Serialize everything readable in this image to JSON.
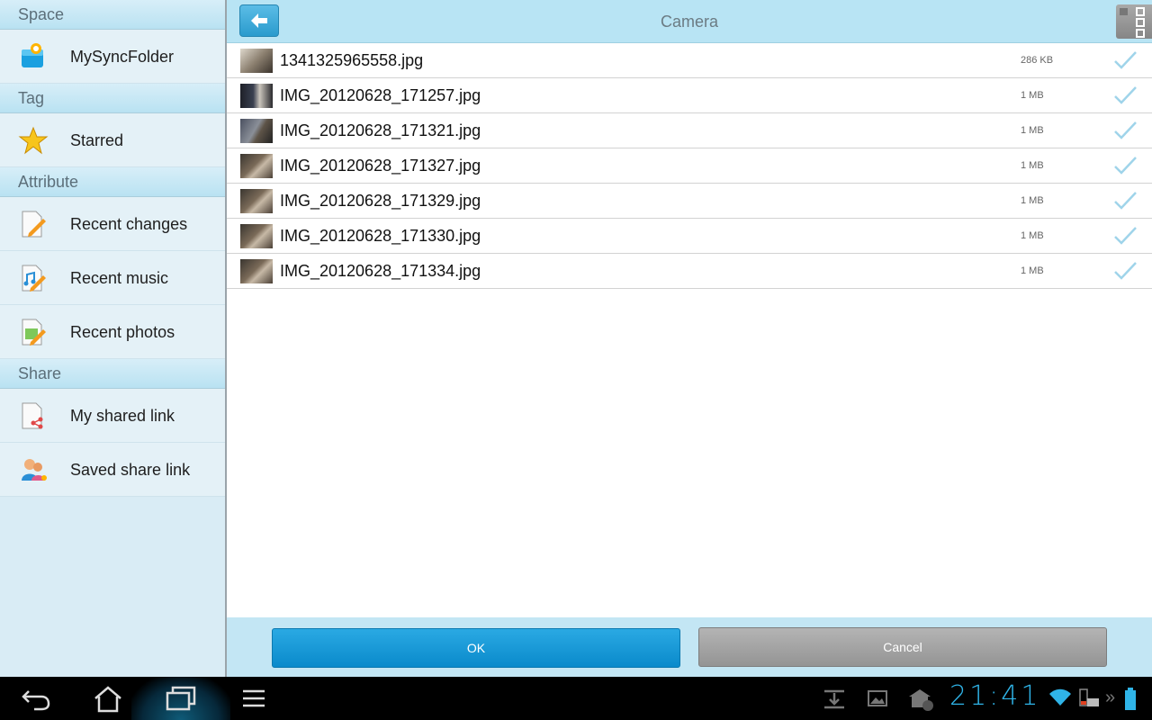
{
  "sidebar": {
    "sections": [
      {
        "header": "Space",
        "items": [
          {
            "label": "MySyncFolder",
            "icon": "sync-folder-icon"
          }
        ]
      },
      {
        "header": "Tag",
        "items": [
          {
            "label": "Starred",
            "icon": "star-icon"
          }
        ]
      },
      {
        "header": "Attribute",
        "items": [
          {
            "label": "Recent changes",
            "icon": "recent-changes-icon"
          },
          {
            "label": "Recent music",
            "icon": "recent-music-icon"
          },
          {
            "label": "Recent photos",
            "icon": "recent-photos-icon"
          }
        ]
      },
      {
        "header": "Share",
        "items": [
          {
            "label": "My shared link",
            "icon": "shared-link-icon"
          },
          {
            "label": "Saved share link",
            "icon": "saved-share-link-icon"
          }
        ]
      }
    ]
  },
  "header": {
    "title": "Camera",
    "back_icon": "back-arrow-icon",
    "view_icon": "grid-view-icon"
  },
  "files": [
    {
      "name": "1341325965558.jpg",
      "size": "286 KB",
      "checked": true
    },
    {
      "name": "IMG_20120628_171257.jpg",
      "size": "1 MB",
      "checked": true
    },
    {
      "name": "IMG_20120628_171321.jpg",
      "size": "1 MB",
      "checked": true
    },
    {
      "name": "IMG_20120628_171327.jpg",
      "size": "1 MB",
      "checked": true
    },
    {
      "name": "IMG_20120628_171329.jpg",
      "size": "1 MB",
      "checked": true
    },
    {
      "name": "IMG_20120628_171330.jpg",
      "size": "1 MB",
      "checked": true
    },
    {
      "name": "IMG_20120628_171334.jpg",
      "size": "1 MB",
      "checked": true
    }
  ],
  "buttons": {
    "ok": "OK",
    "cancel": "Cancel"
  },
  "system_bar": {
    "time": "21:41"
  },
  "colors": {
    "accent": "#0a8acb",
    "header_bg": "#b8e4f4",
    "sidebar_bg": "#d9ecf5",
    "clock": "#2fb4e8"
  }
}
